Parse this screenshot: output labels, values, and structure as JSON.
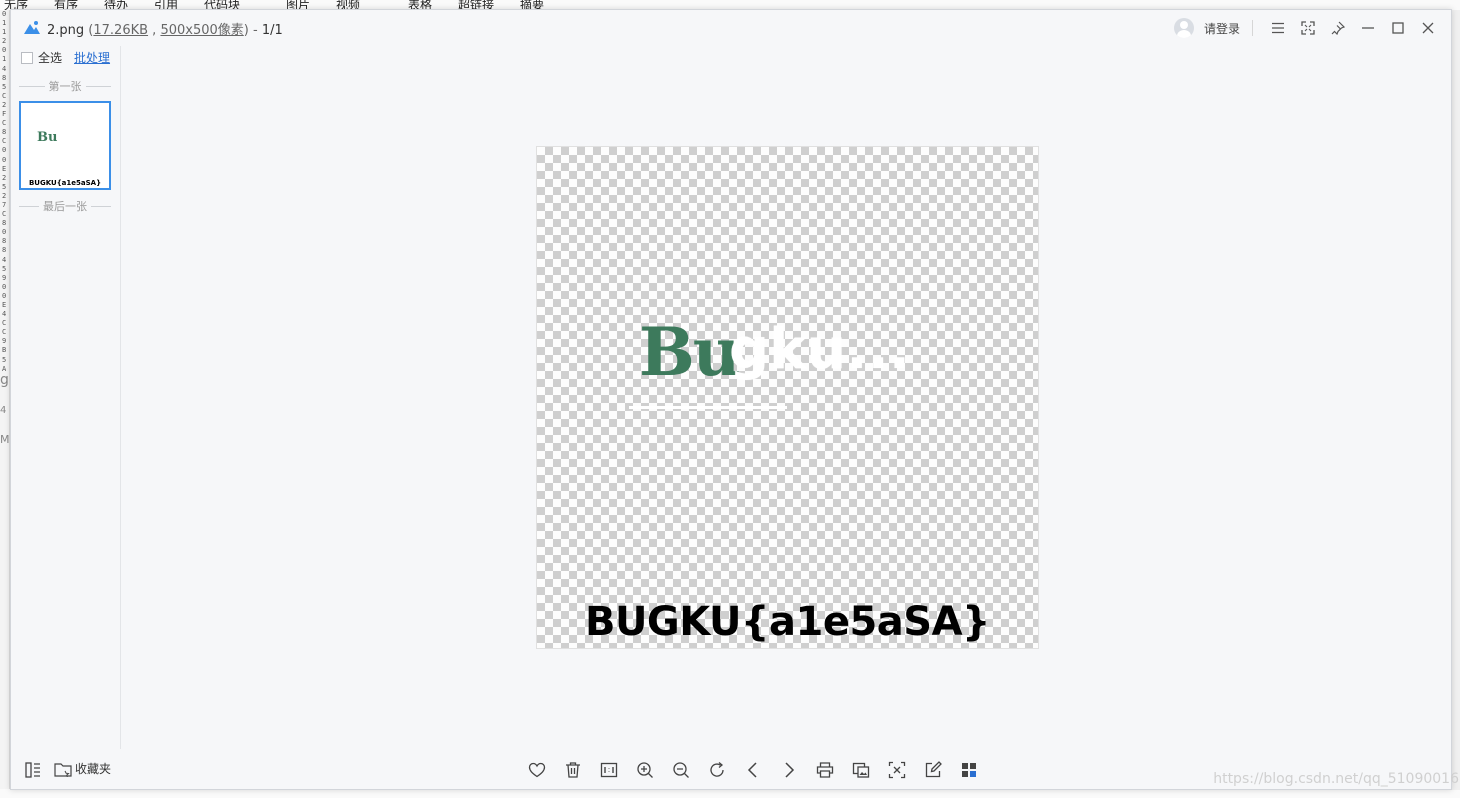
{
  "background_app": {
    "menu_items": [
      "无序",
      "有序",
      "待办",
      "引用",
      "代码块",
      "图片",
      "视频",
      "表格",
      "超链接",
      "摘要"
    ],
    "gutter_digits": "0\n1\n1\n2\n0\n1\n4\n8\n5\nC\n2\nF\nC\n8\nC\n0\n0\nE\n2\n5\n2\n7\nC\n8\n0\n8\n8\n4\n5\n9\n0\n0\nE\n4\nC\nC\n9\nB\n5\nA",
    "gutter_fragments": [
      "g",
      "4",
      "MI"
    ]
  },
  "viewer": {
    "title_prefix": "2.png",
    "file_size": "17.26KB",
    "dimensions": "500x500像素",
    "counter": "1/1",
    "login_label": "请登录",
    "sidebar": {
      "select_all": "全选",
      "batch_process": "批处理",
      "first_label": "第一张",
      "last_label": "最后一张",
      "thumb_logo": "Bu",
      "thumb_flag": "BUGKU{a1e5aSA}"
    },
    "image": {
      "logo_b": "Bu",
      "logo_rest": "gku...",
      "flag_text": "BUGKU{a1e5aSA}"
    },
    "favorites_label": "收藏夹",
    "watermark": "https://blog.csdn.net/qq_51090016",
    "colors": {
      "accent": "#3b8fe8",
      "logo_green": "#3d7a5c",
      "link_blue": "#2a6fd1"
    }
  }
}
